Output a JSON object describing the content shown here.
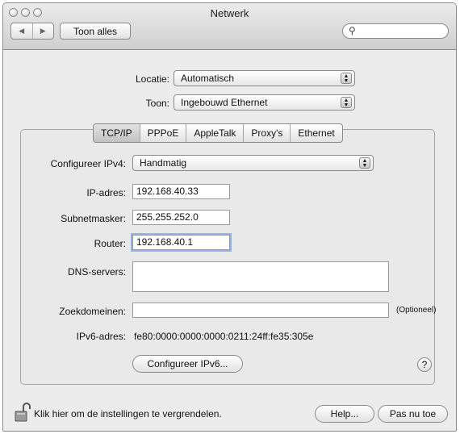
{
  "window": {
    "title": "Netwerk"
  },
  "toolbar": {
    "back_icon": "back-arrow-icon",
    "forward_icon": "forward-arrow-icon",
    "show_all": "Toon alles",
    "search_value": "",
    "search_icon": "search-icon"
  },
  "location": {
    "label": "Locatie:",
    "value": "Automatisch"
  },
  "show": {
    "label": "Toon:",
    "value": "Ingebouwd Ethernet"
  },
  "tabs": [
    {
      "label": "TCP/IP",
      "active": true
    },
    {
      "label": "PPPoE",
      "active": false
    },
    {
      "label": "AppleTalk",
      "active": false
    },
    {
      "label": "Proxy's",
      "active": false
    },
    {
      "label": "Ethernet",
      "active": false
    }
  ],
  "tcpip": {
    "configure_label": "Configureer IPv4:",
    "configure_value": "Handmatig",
    "ip_label": "IP-adres:",
    "ip_value": "192.168.40.33",
    "subnet_label": "Subnetmasker:",
    "subnet_value": "255.255.252.0",
    "router_label": "Router:",
    "router_value": "192.168.40.1",
    "dns_label": "DNS-servers:",
    "dns_value": "",
    "search_domains_label": "Zoekdomeinen:",
    "search_domains_value": "",
    "optional_note": "(Optioneel)",
    "ipv6_label": "IPv6-adres:",
    "ipv6_value": "fe80:0000:0000:0000:0211:24ff:fe35:305e",
    "configure_ipv6_button": "Configureer IPv6...",
    "help_button": "?"
  },
  "footer": {
    "lock_text": "Klik hier om de instellingen te vergrendelen.",
    "help_button": "Help...",
    "apply_button": "Pas nu toe"
  }
}
